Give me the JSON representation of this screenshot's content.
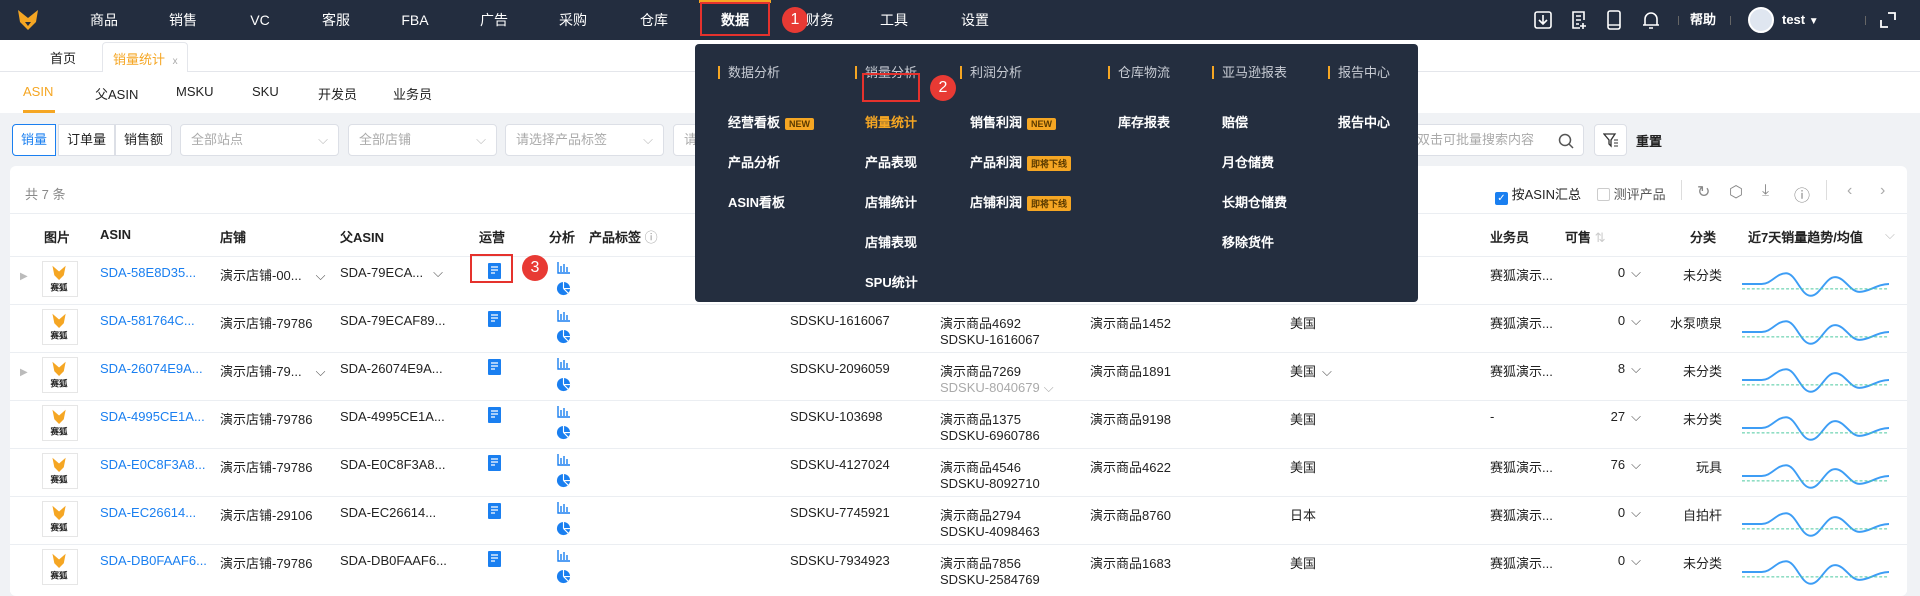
{
  "topnav": {
    "items": [
      "商品",
      "销售",
      "VC",
      "客服",
      "FBA",
      "广告",
      "采购",
      "仓库",
      "数据",
      "财务",
      "工具",
      "设置"
    ],
    "active": "数据",
    "help": "帮助",
    "user": "test",
    "icons": [
      "download-icon",
      "add-document-icon",
      "mobile-icon",
      "bell-icon"
    ]
  },
  "tabs": {
    "home": "首页",
    "current": "销量统计",
    "close": "x"
  },
  "subtabs": [
    "ASIN",
    "父ASIN",
    "MSKU",
    "SKU",
    "开发员",
    "业务员"
  ],
  "filters": {
    "segments": [
      "销量",
      "订单量",
      "销售额"
    ],
    "site_placeholder": "全部站点",
    "shop_placeholder": "全部店铺",
    "tag_placeholder": "请选择产品标签",
    "partial_placeholder": "请",
    "search_placeholder": "双击可批量搜索内容",
    "reset": "重置"
  },
  "toolbar": {
    "total": "共 7 条",
    "by_asin": "按ASIN汇总",
    "by_asin_checked": true,
    "review": "测评产品",
    "review_checked": false
  },
  "columns": {
    "image": "图片",
    "asin": "ASIN",
    "shop": "店铺",
    "parent_asin": "父ASIN",
    "ops": "运营",
    "analysis": "分析",
    "tags": "产品标签",
    "salesperson": "业务员",
    "available": "可售",
    "category": "分类",
    "trend": "近7天销量趋势/均值"
  },
  "logo_text": "赛狐",
  "rows": [
    {
      "asin": "SDA-58E8D35...",
      "shop": "演示店铺-00...",
      "shop_dd": true,
      "parent": "SDA-79ECA...",
      "parent_dd": true,
      "sku": "",
      "p1": "",
      "p2": "",
      "p2_muted": false,
      "p3": "",
      "country": "",
      "country_dd": false,
      "sales": "赛狐演示...",
      "avail": "0",
      "cat": "未分类",
      "expand": true
    },
    {
      "asin": "SDA-581764C...",
      "shop": "演示店铺-79786",
      "shop_dd": false,
      "parent": "SDA-79ECAF89...",
      "parent_dd": false,
      "sku": "SDSKU-1616067",
      "p1": "演示商品4692",
      "p2": "SDSKU-1616067",
      "p2_muted": false,
      "p3": "演示商品1452",
      "country": "美国",
      "country_dd": false,
      "sales": "赛狐演示...",
      "avail": "0",
      "cat": "水泵喷泉",
      "expand": false
    },
    {
      "asin": "SDA-26074E9A...",
      "shop": "演示店铺-79...",
      "shop_dd": true,
      "parent": "SDA-26074E9A...",
      "parent_dd": false,
      "sku": "SDSKU-2096059",
      "p1": "演示商品7269",
      "p2": "SDSKU-8040679",
      "p2_muted": true,
      "p3": "演示商品1891",
      "country": "美国",
      "country_dd": true,
      "sales": "赛狐演示...",
      "avail": "8",
      "cat": "未分类",
      "expand": true
    },
    {
      "asin": "SDA-4995CE1A...",
      "shop": "演示店铺-79786",
      "shop_dd": false,
      "parent": "SDA-4995CE1A...",
      "parent_dd": false,
      "sku": "SDSKU-103698",
      "p1": "演示商品1375",
      "p2": "SDSKU-6960786",
      "p2_muted": false,
      "p3": "演示商品9198",
      "country": "美国",
      "country_dd": false,
      "sales": "-",
      "avail": "27",
      "cat": "未分类",
      "expand": false
    },
    {
      "asin": "SDA-E0C8F3A8...",
      "shop": "演示店铺-79786",
      "shop_dd": false,
      "parent": "SDA-E0C8F3A8...",
      "parent_dd": false,
      "sku": "SDSKU-4127024",
      "p1": "演示商品4546",
      "p2": "SDSKU-8092710",
      "p2_muted": false,
      "p3": "演示商品4622",
      "country": "美国",
      "country_dd": false,
      "sales": "赛狐演示...",
      "avail": "76",
      "cat": "玩具",
      "expand": false
    },
    {
      "asin": "SDA-EC26614...",
      "shop": "演示店铺-29106",
      "shop_dd": false,
      "parent": "SDA-EC26614...",
      "parent_dd": false,
      "sku": "SDSKU-7745921",
      "p1": "演示商品2794",
      "p2": "SDSKU-4098463",
      "p2_muted": false,
      "p3": "演示商品8760",
      "country": "日本",
      "country_dd": false,
      "sales": "赛狐演示...",
      "avail": "0",
      "cat": "自拍杆",
      "expand": false
    },
    {
      "asin": "SDA-DB0FAAF6...",
      "shop": "演示店铺-79786",
      "shop_dd": false,
      "parent": "SDA-DB0FAAF6...",
      "parent_dd": false,
      "sku": "SDSKU-7934923",
      "p1": "演示商品7856",
      "p2": "SDSKU-2584769",
      "p2_muted": false,
      "p3": "演示商品1683",
      "country": "美国",
      "country_dd": false,
      "sales": "赛狐演示...",
      "avail": "0",
      "cat": "未分类",
      "expand": false
    }
  ],
  "menu": {
    "columns": [
      {
        "title": "数据分析",
        "items": [
          {
            "label": "经营看板",
            "tag": "NEW"
          },
          {
            "label": "产品分析",
            "tag": ""
          },
          {
            "label": "ASIN看板",
            "tag": ""
          }
        ]
      },
      {
        "title": "销量分析",
        "items": [
          {
            "label": "销量统计",
            "tag": "",
            "active": true
          },
          {
            "label": "产品表现",
            "tag": ""
          },
          {
            "label": "店铺统计",
            "tag": ""
          },
          {
            "label": "店铺表现",
            "tag": ""
          },
          {
            "label": "SPU统计",
            "tag": ""
          }
        ]
      },
      {
        "title": "利润分析",
        "items": [
          {
            "label": "销售利润",
            "tag": "NEW"
          },
          {
            "label": "产品利润",
            "tag": "即将下线"
          },
          {
            "label": "店铺利润",
            "tag": "即将下线"
          }
        ]
      },
      {
        "title": "仓库物流",
        "items": [
          {
            "label": "库存报表",
            "tag": ""
          }
        ]
      },
      {
        "title": "亚马逊报表",
        "items": [
          {
            "label": "赔偿",
            "tag": ""
          },
          {
            "label": "月仓储费",
            "tag": ""
          },
          {
            "label": "长期仓储费",
            "tag": ""
          },
          {
            "label": "移除货件",
            "tag": ""
          }
        ]
      },
      {
        "title": "报告中心",
        "items": [
          {
            "label": "报告中心",
            "tag": ""
          }
        ]
      }
    ]
  },
  "annotations": [
    "1",
    "2",
    "3"
  ],
  "colors": {
    "topbar": "#232d3f",
    "accent": "#f5a623",
    "link": "#1a7ff0",
    "annotation": "#e83a34"
  }
}
